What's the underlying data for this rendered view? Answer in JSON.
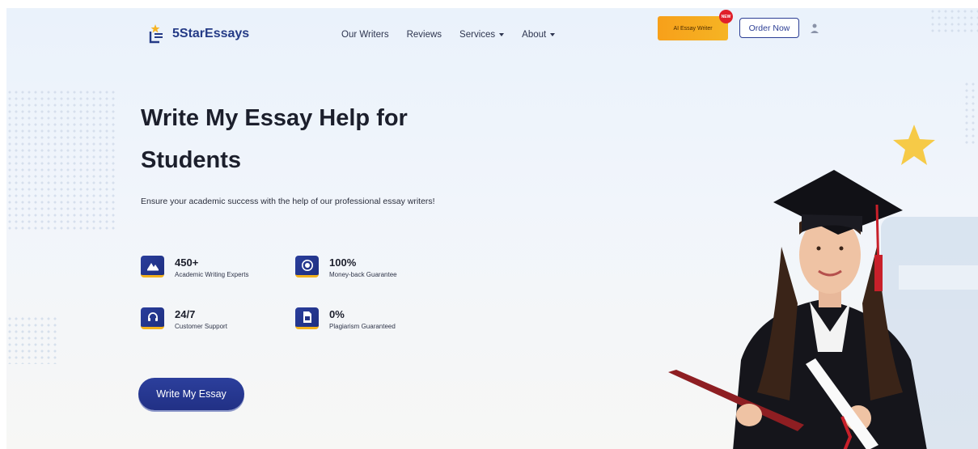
{
  "brand": {
    "name": "5StarEssays"
  },
  "nav": {
    "items": [
      {
        "label": "Our Writers",
        "dropdown": false
      },
      {
        "label": "Reviews",
        "dropdown": false
      },
      {
        "label": "Services",
        "dropdown": true
      },
      {
        "label": "About",
        "dropdown": true
      }
    ],
    "ai_button": "AI Essay Writer",
    "ai_badge": "NEW",
    "order_button": "Order Now"
  },
  "hero": {
    "title_line1": "Write My Essay Help for",
    "title_line2": "Students",
    "subtitle": "Ensure your academic success with the help of our professional essay writers!",
    "stats": [
      {
        "value": "450+",
        "label": "Academic Writing Experts",
        "icon": "writer-icon"
      },
      {
        "value": "100%",
        "label": "Money-back Guarantee",
        "icon": "money-back-icon"
      },
      {
        "value": "24/7",
        "label": "Customer Support",
        "icon": "headset-icon"
      },
      {
        "value": "0%",
        "label": "Plagiarism Guaranteed",
        "icon": "document-icon"
      }
    ],
    "cta": "Write My Essay"
  },
  "colors": {
    "brand_blue": "#243a86",
    "accent_orange": "#f7a01a",
    "badge_red": "#e0202a",
    "star_yellow": "#f6c533"
  }
}
